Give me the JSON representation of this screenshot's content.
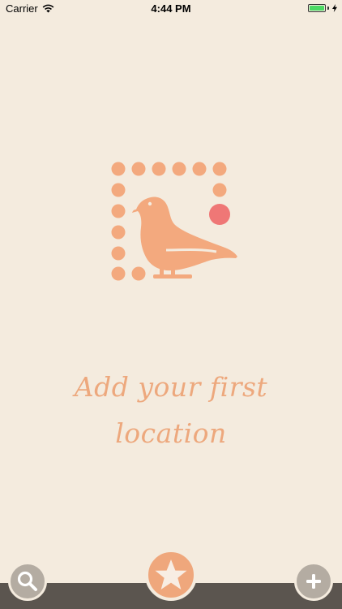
{
  "status_bar": {
    "carrier": "Carrier",
    "time": "4:44 PM",
    "wifi_icon": "wifi-icon",
    "battery_icon": "battery-icon",
    "charging_icon": "bolt-icon",
    "battery_color": "#4cd964"
  },
  "logo": {
    "icon": "pigeon-logo-icon",
    "color": "#f3a97e",
    "dot_accent_color": "#ef7776"
  },
  "empty_state": {
    "line1": "Add your first",
    "line2": "location"
  },
  "toolbar": {
    "search_icon": "search-icon",
    "favorites_icon": "star-icon",
    "add_icon": "plus-icon",
    "accent_color": "#efa77c",
    "button_color": "#b4aca2",
    "bar_color": "#5b554f"
  },
  "background_color": "#f4ebde"
}
